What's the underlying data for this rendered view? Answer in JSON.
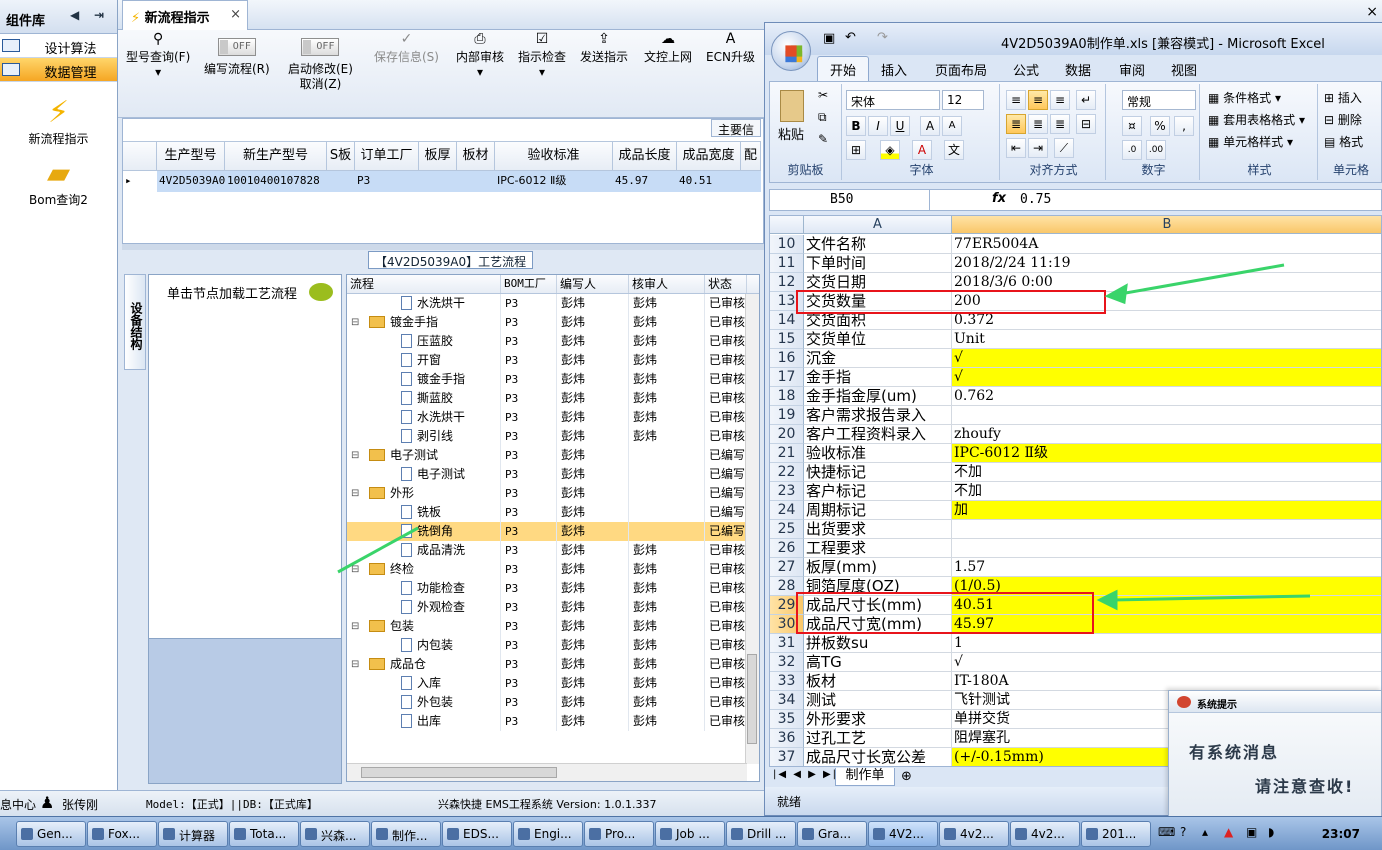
{
  "left_nav": {
    "title": "组件库",
    "items": [
      {
        "label": "设计算法"
      },
      {
        "label": "数据管理"
      }
    ],
    "shortcuts": [
      {
        "label": "新流程指示",
        "icon": "lightning-icon"
      },
      {
        "label": "Bom查询2",
        "icon": "folder-icon"
      }
    ]
  },
  "doc_tab": {
    "label": "新流程指示",
    "close": "×"
  },
  "window_close": "×",
  "toolbar": {
    "model_query": "型号查询(F)",
    "write_process": "编写流程(R)",
    "toggle_off": "OFF",
    "start_modify": "启动修改(E)",
    "cancel": "取消(Z)",
    "save": "保存信息(S)",
    "internal_review": "内部审核",
    "instruction_check": "指示检查",
    "send_instruction": "发送指示",
    "doc_online": "文控上网",
    "ecn_upgrade": "ECN升级"
  },
  "grid": {
    "main_label": "主要信",
    "columns": [
      "生产型号",
      "新生产型号",
      "S板",
      "订单工厂",
      "板厚",
      "板材",
      "验收标准",
      "成品长度",
      "成品宽度",
      "配"
    ],
    "rows": [
      [
        "4V2D5039A0",
        "10010400107828",
        "",
        "P3",
        "",
        "",
        "IPC-6012 Ⅱ级",
        "45.97",
        "40.51",
        ""
      ]
    ]
  },
  "process": {
    "title": "【4V2D5039A0】工艺流程",
    "side_tab": "设备结构",
    "hint": "单击节点加载工艺流程",
    "columns": [
      "流程",
      "BOM工厂",
      "编写人",
      "核审人",
      "状态"
    ],
    "rows": [
      {
        "name": "水洗烘干",
        "type": "file",
        "level": 2,
        "bom": "P3",
        "writer": "彭炜",
        "reviewer": "彭炜",
        "status": "已审核"
      },
      {
        "name": "镀金手指",
        "type": "folder",
        "level": 1,
        "bom": "P3",
        "writer": "彭炜",
        "reviewer": "彭炜",
        "status": "已审核"
      },
      {
        "name": "压蓝胶",
        "type": "file",
        "level": 2,
        "bom": "P3",
        "writer": "彭炜",
        "reviewer": "彭炜",
        "status": "已审核"
      },
      {
        "name": "开窗",
        "type": "file",
        "level": 2,
        "bom": "P3",
        "writer": "彭炜",
        "reviewer": "彭炜",
        "status": "已审核"
      },
      {
        "name": "镀金手指",
        "type": "file",
        "level": 2,
        "bom": "P3",
        "writer": "彭炜",
        "reviewer": "彭炜",
        "status": "已审核"
      },
      {
        "name": "撕蓝胶",
        "type": "file",
        "level": 2,
        "bom": "P3",
        "writer": "彭炜",
        "reviewer": "彭炜",
        "status": "已审核"
      },
      {
        "name": "水洗烘干",
        "type": "file",
        "level": 2,
        "bom": "P3",
        "writer": "彭炜",
        "reviewer": "彭炜",
        "status": "已审核"
      },
      {
        "name": "剥引线",
        "type": "file",
        "level": 2,
        "bom": "P3",
        "writer": "彭炜",
        "reviewer": "彭炜",
        "status": "已审核"
      },
      {
        "name": "电子测试",
        "type": "folder",
        "level": 1,
        "bom": "P3",
        "writer": "彭炜",
        "reviewer": "",
        "status": "已编写"
      },
      {
        "name": "电子测试",
        "type": "file",
        "level": 2,
        "bom": "P3",
        "writer": "彭炜",
        "reviewer": "",
        "status": "已编写"
      },
      {
        "name": "外形",
        "type": "folder",
        "level": 1,
        "bom": "P3",
        "writer": "彭炜",
        "reviewer": "",
        "status": "已编写"
      },
      {
        "name": "铣板",
        "type": "file",
        "level": 2,
        "bom": "P3",
        "writer": "彭炜",
        "reviewer": "",
        "status": "已编写"
      },
      {
        "name": "铣倒角",
        "type": "file",
        "level": 2,
        "bom": "P3",
        "writer": "彭炜",
        "reviewer": "",
        "status": "已编写",
        "selected": true
      },
      {
        "name": "成品清洗",
        "type": "file",
        "level": 2,
        "bom": "P3",
        "writer": "彭炜",
        "reviewer": "彭炜",
        "status": "已审核"
      },
      {
        "name": "终检",
        "type": "folder",
        "level": 1,
        "bom": "P3",
        "writer": "彭炜",
        "reviewer": "彭炜",
        "status": "已审核"
      },
      {
        "name": "功能检查",
        "type": "file",
        "level": 2,
        "bom": "P3",
        "writer": "彭炜",
        "reviewer": "彭炜",
        "status": "已审核"
      },
      {
        "name": "外观检查",
        "type": "file",
        "level": 2,
        "bom": "P3",
        "writer": "彭炜",
        "reviewer": "彭炜",
        "status": "已审核"
      },
      {
        "name": "包装",
        "type": "folder",
        "level": 1,
        "bom": "P3",
        "writer": "彭炜",
        "reviewer": "彭炜",
        "status": "已审核"
      },
      {
        "name": "内包装",
        "type": "file",
        "level": 2,
        "bom": "P3",
        "writer": "彭炜",
        "reviewer": "彭炜",
        "status": "已审核"
      },
      {
        "name": "成品仓",
        "type": "folder",
        "level": 1,
        "bom": "P3",
        "writer": "彭炜",
        "reviewer": "彭炜",
        "status": "已审核"
      },
      {
        "name": "入库",
        "type": "file",
        "level": 2,
        "bom": "P3",
        "writer": "彭炜",
        "reviewer": "彭炜",
        "status": "已审核"
      },
      {
        "name": "外包装",
        "type": "file",
        "level": 2,
        "bom": "P3",
        "writer": "彭炜",
        "reviewer": "彭炜",
        "status": "已审核"
      },
      {
        "name": "出库",
        "type": "file",
        "level": 2,
        "bom": "P3",
        "writer": "彭炜",
        "reviewer": "彭炜",
        "status": "已审核"
      }
    ]
  },
  "status_bar": {
    "center": "息中心",
    "user": "张传刚",
    "model": "Model:【正式】||DB:【正式库】",
    "system": "兴森快捷 EMS工程系统 Version: 1.0.1.337"
  },
  "excel": {
    "title": "4V2D5039A0制作单.xls [兼容模式] - Microsoft Excel",
    "tabs": [
      "开始",
      "插入",
      "页面布局",
      "公式",
      "数据",
      "审阅",
      "视图"
    ],
    "ribbon": {
      "paste": "粘贴",
      "clipboard": "剪贴板",
      "font_name": "宋体",
      "font_size": "12",
      "font": "字体",
      "alignment": "对齐方式",
      "number_format": "常规",
      "number": "数字",
      "cond_format": "条件格式",
      "table_format": "套用表格格式",
      "cell_style": "单元格样式",
      "styles": "样式",
      "insert": "插入",
      "delete": "删除",
      "format": "格式",
      "cells": "单元格"
    },
    "name_box": "B50",
    "fx": "fx",
    "formula": "0.75",
    "columns": [
      "A",
      "B"
    ],
    "rows": [
      {
        "n": "10",
        "a": "文件名称",
        "b": "77ER5004A",
        "y": false
      },
      {
        "n": "11",
        "a": "下单时间",
        "b": "2018/2/24 11:19",
        "y": false
      },
      {
        "n": "12",
        "a": "交货日期",
        "b": "2018/3/6 0:00",
        "y": false
      },
      {
        "n": "13",
        "a": "交货数量",
        "b": "200",
        "y": false
      },
      {
        "n": "14",
        "a": "交货面积",
        "b": "0.372",
        "y": false
      },
      {
        "n": "15",
        "a": "交货单位",
        "b": "Unit",
        "y": false
      },
      {
        "n": "16",
        "a": "沉金",
        "b": "√",
        "y": true
      },
      {
        "n": "17",
        "a": "金手指",
        "b": "√",
        "y": true
      },
      {
        "n": "18",
        "a": "金手指金厚(um)",
        "b": "0.762",
        "y": false
      },
      {
        "n": "19",
        "a": "客户需求报告录入",
        "b": "",
        "y": false
      },
      {
        "n": "20",
        "a": "客户工程资料录入",
        "b": "zhoufy",
        "y": false
      },
      {
        "n": "21",
        "a": "验收标准",
        "b": "IPC-6012 Ⅱ级",
        "y": true
      },
      {
        "n": "22",
        "a": "快捷标记",
        "b": "不加",
        "y": false
      },
      {
        "n": "23",
        "a": "客户标记",
        "b": "不加",
        "y": false
      },
      {
        "n": "24",
        "a": "周期标记",
        "b": "加",
        "y": true
      },
      {
        "n": "25",
        "a": "出货要求",
        "b": "",
        "y": false
      },
      {
        "n": "26",
        "a": "工程要求",
        "b": "",
        "y": false
      },
      {
        "n": "27",
        "a": "板厚(mm)",
        "b": "1.57",
        "y": false
      },
      {
        "n": "28",
        "a": "铜箔厚度(OZ)",
        "b": "(1/0.5)",
        "y": true
      },
      {
        "n": "29",
        "a": "成品尺寸长(mm)",
        "b": "40.51",
        "y": true
      },
      {
        "n": "30",
        "a": "成品尺寸宽(mm)",
        "b": "45.97",
        "y": true
      },
      {
        "n": "31",
        "a": "拼板数su",
        "b": "1",
        "y": false
      },
      {
        "n": "32",
        "a": "高TG",
        "b": "√",
        "y": false
      },
      {
        "n": "33",
        "a": "板材",
        "b": "IT-180A",
        "y": false
      },
      {
        "n": "34",
        "a": "测试",
        "b": "飞针测试",
        "y": false
      },
      {
        "n": "35",
        "a": "外形要求",
        "b": "单拼交货",
        "y": false
      },
      {
        "n": "36",
        "a": "过孔工艺",
        "b": "阻焊塞孔",
        "y": false
      },
      {
        "n": "37",
        "a": "成品尺寸长宽公差",
        "b": "(+/-0.15mm)",
        "y": true
      }
    ],
    "sheet_tab": "制作单",
    "status": "就绪"
  },
  "popup": {
    "title": "系统提示",
    "line1": "有系统消息",
    "line2": "请注意查收!"
  },
  "taskbar": {
    "items": [
      "Gen...",
      "Fox...",
      "计算器",
      "Tota...",
      "兴森...",
      "制作...",
      "EDS...",
      "Engi...",
      "Pro...",
      "Job ...",
      "Drill ...",
      "Gra...",
      "4V2...",
      "4v2...",
      "4v2...",
      "201..."
    ],
    "clock": "23:07"
  },
  "colors": {
    "accent_selection": "#ffd982",
    "excel_highlight": "#ffff00",
    "annotation_box": "#e8141b",
    "annotation_arrow": "#3ad46a"
  }
}
